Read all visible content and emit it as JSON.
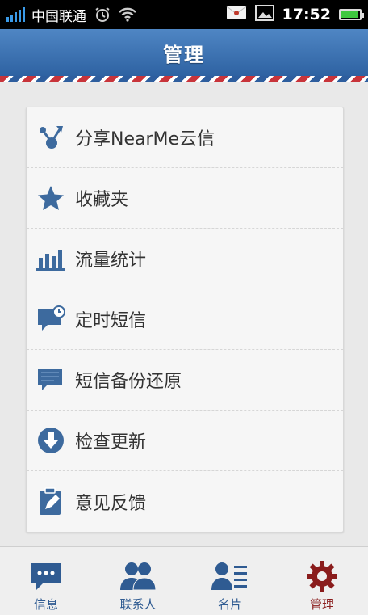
{
  "status_bar": {
    "carrier": "中国联通",
    "time": "17:52",
    "battery_level": 0.9,
    "icons": [
      "signal-icon",
      "alarm-icon",
      "wifi-icon",
      "mail-icon",
      "screenshot-icon",
      "battery-icon"
    ]
  },
  "header": {
    "title": "管理"
  },
  "menu": {
    "items": [
      {
        "label": "分享NearMe云信",
        "icon": "share-icon"
      },
      {
        "label": "收藏夹",
        "icon": "star-icon"
      },
      {
        "label": "流量统计",
        "icon": "bar-chart-icon"
      },
      {
        "label": "定时短信",
        "icon": "scheduled-message-icon"
      },
      {
        "label": "短信备份还原",
        "icon": "message-backup-icon"
      },
      {
        "label": "检查更新",
        "icon": "download-icon"
      },
      {
        "label": "意见反馈",
        "icon": "feedback-icon"
      }
    ]
  },
  "bottom_nav": {
    "items": [
      {
        "label": "信息",
        "icon": "message-icon"
      },
      {
        "label": "联系人",
        "icon": "contacts-icon"
      },
      {
        "label": "名片",
        "icon": "business-card-icon"
      },
      {
        "label": "管理",
        "icon": "gear-icon"
      }
    ],
    "active": "管理"
  },
  "colors": {
    "header_blue": "#3a6fb0",
    "icon_blue": "#3d6a9e",
    "active_red": "#8a1c1c"
  }
}
